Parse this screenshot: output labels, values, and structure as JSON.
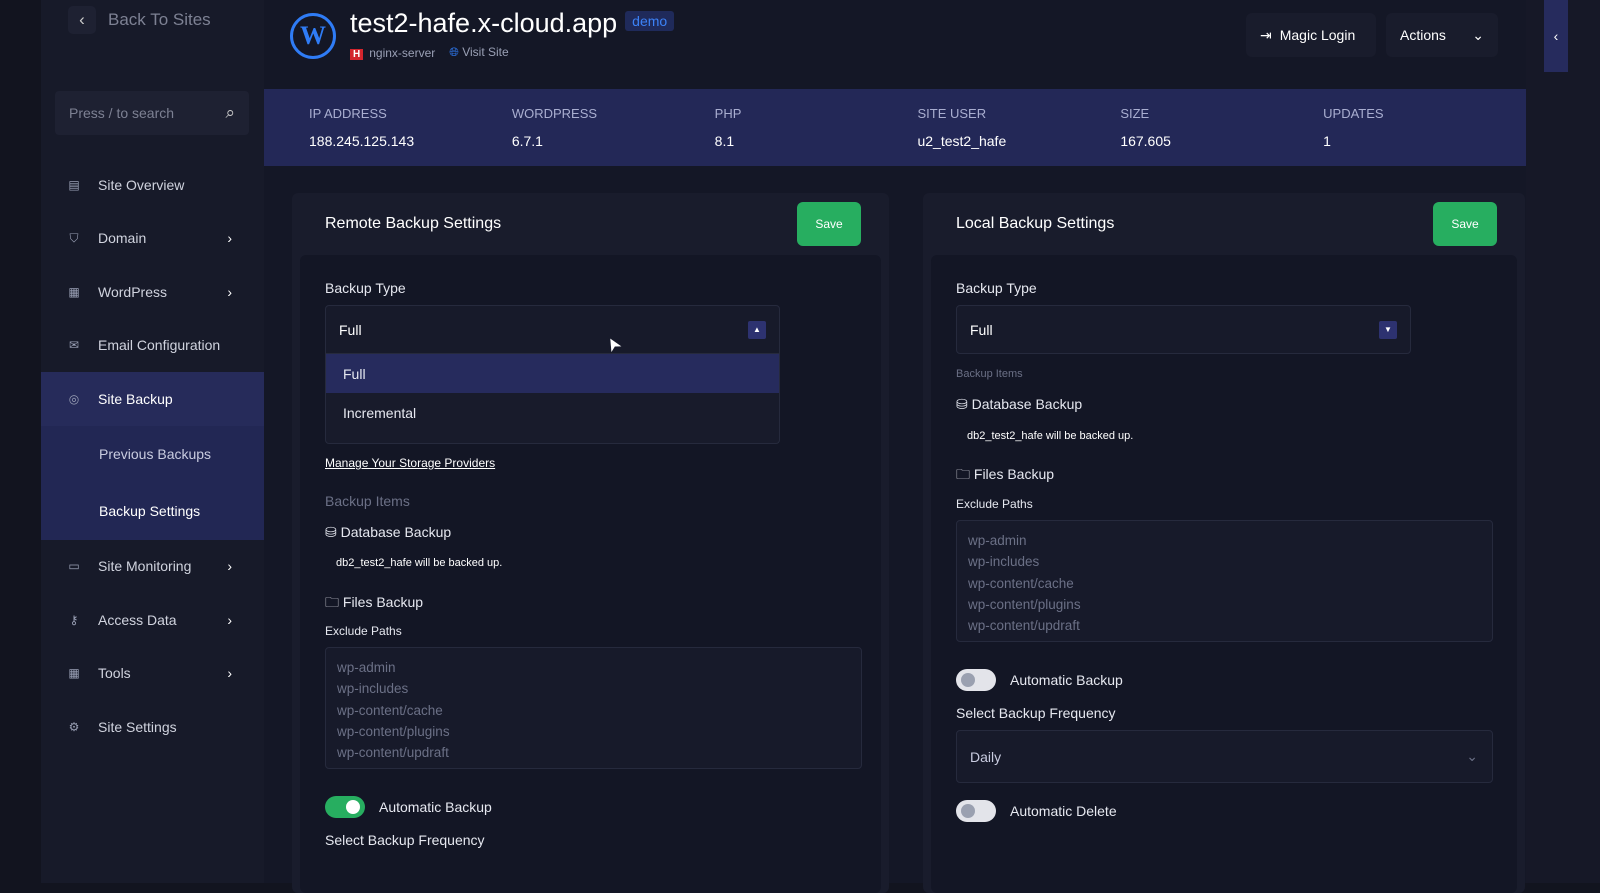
{
  "sidebar": {
    "back": "Back To Sites",
    "search_placeholder": "Press / to search",
    "items": [
      {
        "label": "Site Overview",
        "icon": "▤"
      },
      {
        "label": "Domain",
        "icon": "⛉"
      },
      {
        "label": "WordPress",
        "icon": "▦"
      },
      {
        "label": "Email Configuration",
        "icon": "✉"
      },
      {
        "label": "Site Backup",
        "icon": "◎"
      },
      {
        "label": "Site Monitoring",
        "icon": "▭"
      },
      {
        "label": "Access Data",
        "icon": "⚷"
      },
      {
        "label": "Tools",
        "icon": "▦"
      },
      {
        "label": "Site Settings",
        "icon": "⚙"
      }
    ],
    "sub": [
      "Previous Backups",
      "Backup Settings"
    ]
  },
  "header": {
    "title": "test2-hafe.x-cloud.app",
    "badge": "demo",
    "server": "nginx-server",
    "visit": "Visit Site",
    "magic_login": "Magic Login",
    "actions": "Actions"
  },
  "stats": [
    {
      "label": "IP ADDRESS",
      "value": "188.245.125.143"
    },
    {
      "label": "WORDPRESS",
      "value": "6.7.1"
    },
    {
      "label": "PHP",
      "value": "8.1"
    },
    {
      "label": "SITE USER",
      "value": "u2_test2_hafe"
    },
    {
      "label": "SIZE",
      "value": "167.605"
    },
    {
      "label": "UPDATES",
      "value": "1"
    }
  ],
  "remote": {
    "title": "Remote Backup Settings",
    "save": "Save",
    "backup_type_label": "Backup Type",
    "backup_type": "Full",
    "options": [
      "Full",
      "Incremental"
    ],
    "manage_link": "Manage Your Storage Providers",
    "items_label": "Backup Items",
    "db_label": "Database Backup",
    "db_note": "db2_test2_hafe will be backed up.",
    "files_label": "Files Backup",
    "exclude_label": "Exclude Paths",
    "exclude": "wp-admin\nwp-includes\nwp-content/cache\nwp-content/plugins\nwp-content/updraft\nwp-content/uploads",
    "auto_backup": "Automatic Backup",
    "auto_backup_on": true,
    "freq_label": "Select Backup Frequency"
  },
  "local": {
    "title": "Local Backup Settings",
    "save": "Save",
    "backup_type_label": "Backup Type",
    "backup_type": "Full",
    "items_label": "Backup Items",
    "db_label": "Database Backup",
    "db_note": "db2_test2_hafe will be backed up.",
    "files_label": "Files Backup",
    "exclude_label": "Exclude Paths",
    "exclude": "wp-admin\nwp-includes\nwp-content/cache\nwp-content/plugins\nwp-content/updraft\nwp-content/uploads",
    "auto_backup": "Automatic Backup",
    "auto_backup_on": false,
    "freq_label": "Select Backup Frequency",
    "freq": "Daily",
    "auto_delete": "Automatic Delete",
    "auto_delete_on": false
  }
}
